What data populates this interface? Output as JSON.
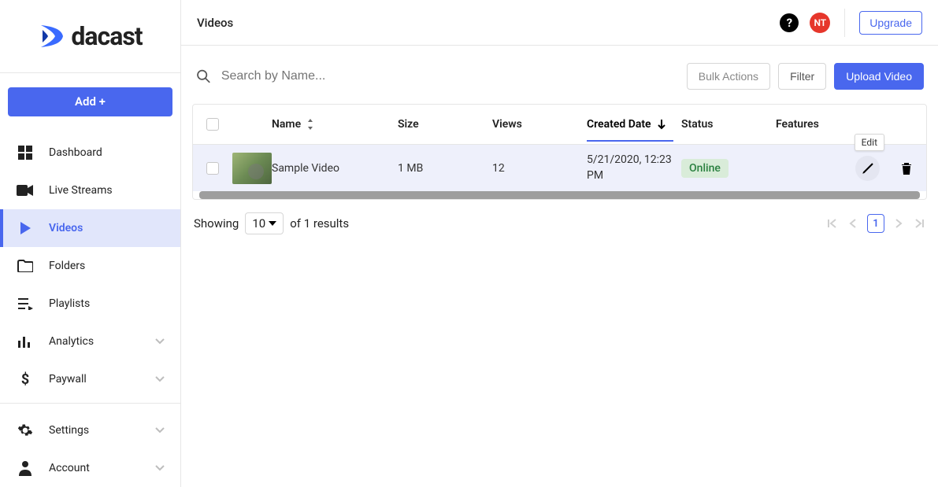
{
  "brand": {
    "name": "dacast"
  },
  "add_button": "Add +",
  "sidebar": [
    {
      "icon": "dashboard",
      "label": "Dashboard",
      "active": false,
      "chevron": false
    },
    {
      "icon": "camera",
      "label": "Live Streams",
      "active": false,
      "chevron": false
    },
    {
      "icon": "play",
      "label": "Videos",
      "active": true,
      "chevron": false
    },
    {
      "icon": "folder",
      "label": "Folders",
      "active": false,
      "chevron": false
    },
    {
      "icon": "playlist",
      "label": "Playlists",
      "active": false,
      "chevron": false
    },
    {
      "icon": "analytics",
      "label": "Analytics",
      "active": false,
      "chevron": true
    },
    {
      "icon": "dollar",
      "label": "Paywall",
      "active": false,
      "chevron": true
    }
  ],
  "sidebar_bottom": [
    {
      "icon": "gear",
      "label": "Settings",
      "chevron": true
    },
    {
      "icon": "person",
      "label": "Account",
      "chevron": true
    }
  ],
  "header": {
    "title": "Videos",
    "avatar_initials": "NT",
    "help": "?",
    "upgrade": "Upgrade"
  },
  "toolbar": {
    "search_placeholder": "Search by Name...",
    "bulk_actions": "Bulk Actions",
    "filter": "Filter",
    "upload": "Upload Video"
  },
  "table": {
    "columns": {
      "name": "Name",
      "size": "Size",
      "views": "Views",
      "created": "Created Date",
      "status": "Status",
      "features": "Features"
    },
    "rows": [
      {
        "name": "Sample Video",
        "size": "1 MB",
        "views": "12",
        "created": "5/21/2020, 12:23 PM",
        "status": "Online"
      }
    ]
  },
  "tooltip_edit": "Edit",
  "pagination": {
    "showing_prefix": "Showing",
    "per_page": "10",
    "of_results": "of 1 results",
    "current_page": "1"
  }
}
